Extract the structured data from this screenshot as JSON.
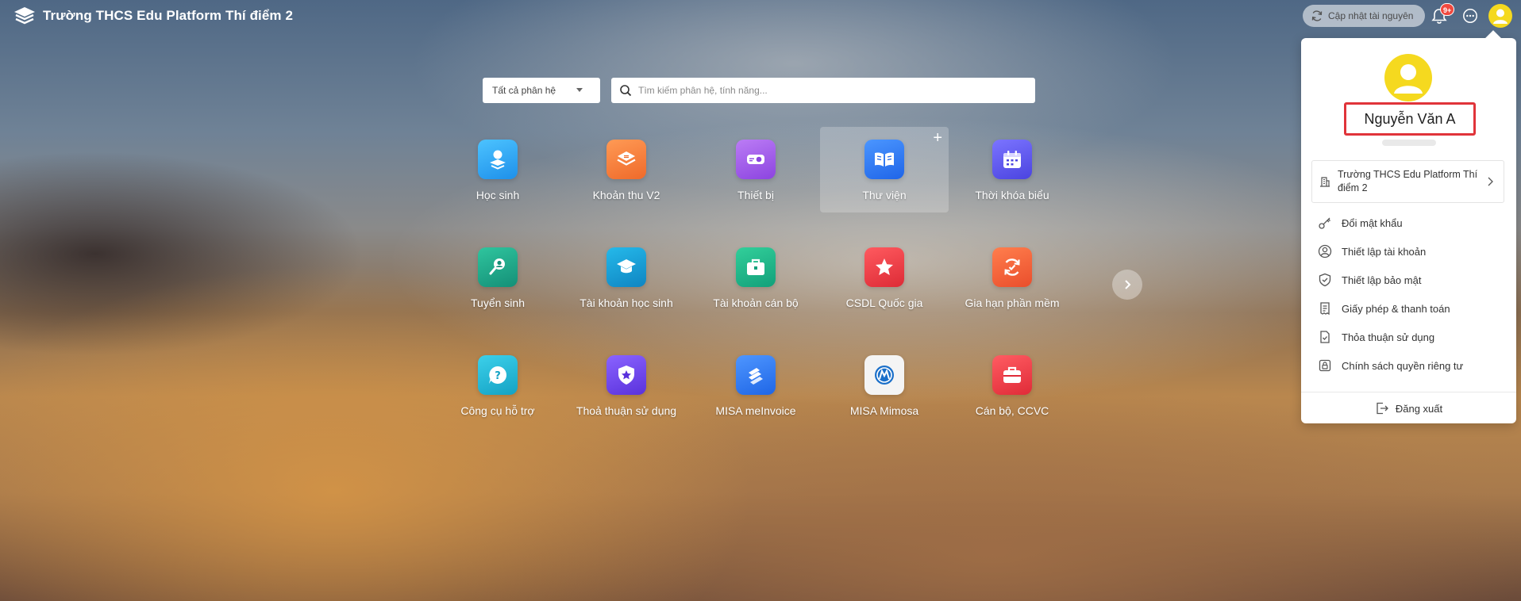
{
  "header": {
    "title": "Trường THCS Edu Platform Thí điểm 2",
    "sync_label": "Cập nhật tài nguyên",
    "notification_badge": "9+"
  },
  "search": {
    "filter_label": "Tất cả phân hệ",
    "placeholder": "Tìm kiếm phân hệ, tính năng..."
  },
  "apps": [
    {
      "label": "Học sinh",
      "icon": "student-icon",
      "color": "#2aa8f2"
    },
    {
      "label": "Khoản thu V2",
      "icon": "fee-icon",
      "color": "#f47a3a"
    },
    {
      "label": "Thiết bị",
      "icon": "projector-icon",
      "color": "#a15be8"
    },
    {
      "label": "Thư viện",
      "icon": "book-icon",
      "color": "#2f7cf6",
      "hovered": true
    },
    {
      "label": "Thời khóa biểu",
      "icon": "calendar-icon",
      "color": "#5a55e8"
    },
    {
      "label": "Tuyển sinh",
      "icon": "search-person-icon",
      "color": "#1fa98a"
    },
    {
      "label": "Tài khoản học sinh",
      "icon": "graduation-cap-icon",
      "color": "#1aa0d6"
    },
    {
      "label": "Tài khoản cán bộ",
      "icon": "briefcase-icon",
      "color": "#1db88d"
    },
    {
      "label": "CSDL Quốc gia",
      "icon": "star-icon",
      "color": "#ec3a44"
    },
    {
      "label": "Gia hạn phần mềm",
      "icon": "renew-icon",
      "color": "#f3643c"
    },
    {
      "label": "Công cụ hỗ trợ",
      "icon": "help-icon",
      "color": "#1eb3d3"
    },
    {
      "label": "Thoả thuận sử dụng",
      "icon": "shield-star-icon",
      "color": "#6d4ae6"
    },
    {
      "label": "MISA meInvoice",
      "icon": "meinvoice-icon",
      "color": "#2e7df2"
    },
    {
      "label": "MISA Mimosa",
      "icon": "mimosa-icon",
      "color": "#f4f4f4"
    },
    {
      "label": "Cán bộ, CCVC",
      "icon": "staff-case-icon",
      "color": "#ee3c45"
    }
  ],
  "menu": {
    "name": "Nguyễn Văn A",
    "school": "Trường THCS Edu Platform Thí điểm 2",
    "items": [
      {
        "label": "Đổi mật khẩu",
        "icon": "key-icon"
      },
      {
        "label": "Thiết lập tài khoản",
        "icon": "user-circle-icon"
      },
      {
        "label": "Thiết lập bảo mật",
        "icon": "shield-check-icon"
      },
      {
        "label": "Giấy phép & thanh toán",
        "icon": "receipt-icon"
      },
      {
        "label": "Thỏa thuận sử dụng",
        "icon": "doc-check-icon"
      },
      {
        "label": "Chính sách quyền riêng tư",
        "icon": "lock-icon"
      }
    ],
    "logout": "Đăng xuất"
  }
}
